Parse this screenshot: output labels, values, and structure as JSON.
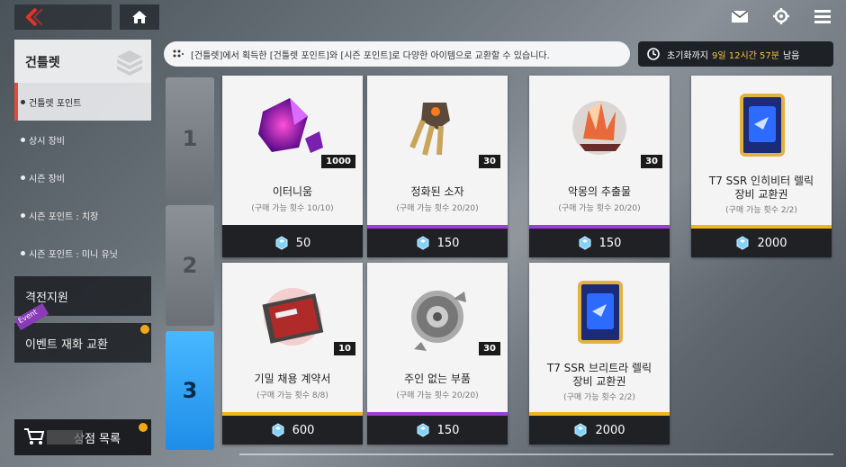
{
  "header": {
    "back_icon": "back-arrow-icon",
    "home_icon": "home-icon",
    "right_icons": [
      "mail-icon",
      "gear-icon",
      "menu-icon"
    ]
  },
  "sidebar": {
    "main_category": "건틀렛",
    "sub_items": [
      {
        "label": "건틀렛 포인트",
        "active": true
      },
      {
        "label": "상시 장비",
        "active": false
      },
      {
        "label": "시즌 장비",
        "active": false
      },
      {
        "label": "시즌 포인트 : 치장",
        "active": false
      },
      {
        "label": "시즌 포인트 : 미니 유닛",
        "active": false
      }
    ],
    "category_2": "격전지원",
    "category_3": "이벤트 재화 교환",
    "event_badge": "Event",
    "shop_list": "상점 목록"
  },
  "pages": [
    "1",
    "2",
    "3"
  ],
  "active_page": "3",
  "notice": "[건틀렛]에서 획득한 [건틀렛 포인트]와 [시즌 포인트]로 다양한 아이템으로 교환할 수 있습니다.",
  "timer": {
    "prefix": "초기화까지",
    "value": "9일 12시간 57분",
    "suffix": "남음"
  },
  "items": [
    {
      "name": "이터니움",
      "name2": "",
      "limit": "(구매 가능 횟수 10/10)",
      "qty": "1000",
      "price": "50",
      "bar_color": "#1f2125"
    },
    {
      "name": "정화된 소자",
      "name2": "",
      "limit": "(구매 가능 횟수 20/20)",
      "qty": "30",
      "price": "150",
      "bar_color": "#9b3fd6"
    },
    {
      "name": "악몽의 추출물",
      "name2": "",
      "limit": "(구매 가능 횟수 20/20)",
      "qty": "30",
      "price": "150",
      "bar_color": "#9b3fd6"
    },
    {
      "name": "T7 SSR 인히비터 렐릭",
      "name2": "장비 교환권",
      "limit": "(구매 가능 횟수 2/2)",
      "qty": "",
      "price": "2000",
      "bar_color": "#f0b61e"
    },
    {
      "name": "기밀 채용 계약서",
      "name2": "",
      "limit": "(구매 가능 횟수 8/8)",
      "qty": "10",
      "price": "600",
      "bar_color": "#f0b61e"
    },
    {
      "name": "주인 없는 부품",
      "name2": "",
      "limit": "(구매 가능 횟수 20/20)",
      "qty": "30",
      "price": "150",
      "bar_color": "#9b3fd6"
    },
    {
      "name": "T7 SSR 브리트라 렐릭",
      "name2": "장비 교환권",
      "limit": "(구매 가능 횟수 2/2)",
      "qty": "",
      "price": "2000",
      "bar_color": "#f0b61e"
    }
  ]
}
